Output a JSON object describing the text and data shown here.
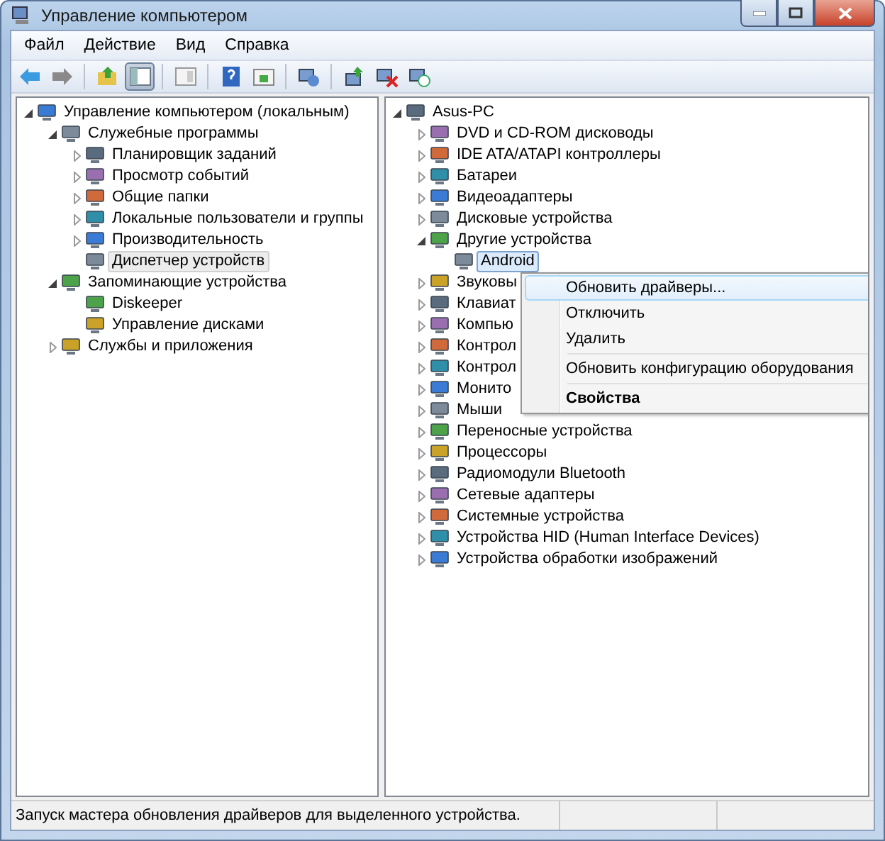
{
  "window": {
    "title": "Управление компьютером"
  },
  "menu_bar": [
    "Файл",
    "Действие",
    "Вид",
    "Справка"
  ],
  "toolbar": [
    [
      {
        "pressed": false
      },
      {
        "pressed": false
      }
    ],
    [
      {
        "pressed": false
      },
      {
        "pressed": true
      }
    ],
    [
      {
        "pressed": false
      }
    ],
    [
      {
        "pressed": false
      },
      {
        "pressed": false
      }
    ],
    [
      {
        "pressed": false
      }
    ],
    [
      {
        "pressed": false
      },
      {
        "pressed": false
      },
      {
        "pressed": false
      }
    ]
  ],
  "left_tree": [
    {
      "label": "Управление компьютером (локальным)",
      "kind": "branch",
      "expanded": true,
      "selected": false,
      "children": [
        {
          "label": "Служебные программы",
          "kind": "branch",
          "expanded": true,
          "selected": false,
          "children": [
            {
              "label": "Планировщик заданий",
              "kind": "branch",
              "expanded": false,
              "selected": false
            },
            {
              "label": "Просмотр событий",
              "kind": "branch",
              "expanded": false,
              "selected": false
            },
            {
              "label": "Общие папки",
              "kind": "branch",
              "expanded": false,
              "selected": false
            },
            {
              "label": "Локальные пользователи и группы",
              "kind": "branch",
              "expanded": false,
              "selected": false
            },
            {
              "label": "Производительность",
              "kind": "branch",
              "expanded": false,
              "selected": false
            },
            {
              "label": "Диспетчер устройств",
              "kind": "leaf",
              "selected": true
            }
          ]
        },
        {
          "label": "Запоминающие устройства",
          "kind": "branch",
          "expanded": true,
          "selected": false,
          "children": [
            {
              "label": "Diskeeper",
              "kind": "leaf",
              "selected": false
            },
            {
              "label": "Управление дисками",
              "kind": "leaf",
              "selected": false
            }
          ]
        },
        {
          "label": "Службы и приложения",
          "kind": "branch",
          "expanded": false,
          "selected": false
        }
      ]
    }
  ],
  "device_tree": [
    {
      "label": "Asus-PC",
      "kind": "branch",
      "expanded": true,
      "selected": false,
      "children": [
        {
          "label": "DVD и CD-ROM дисководы",
          "kind": "branch",
          "expanded": false,
          "selected": false
        },
        {
          "label": "IDE ATA/ATAPI контроллеры",
          "kind": "branch",
          "expanded": false,
          "selected": false
        },
        {
          "label": "Батареи",
          "kind": "branch",
          "expanded": false,
          "selected": false
        },
        {
          "label": "Видеоадаптеры",
          "kind": "branch",
          "expanded": false,
          "selected": false
        },
        {
          "label": "Дисковые устройства",
          "kind": "branch",
          "expanded": false,
          "selected": false
        },
        {
          "label": "Другие устройства",
          "kind": "branch",
          "expanded": true,
          "selected": false,
          "children": [
            {
              "label": "Android",
              "kind": "leaf",
              "selected": true
            }
          ]
        },
        {
          "label": "Звуковы",
          "kind": "branch",
          "expanded": false,
          "selected": false
        },
        {
          "label": "Клавиат",
          "kind": "branch",
          "expanded": false,
          "selected": false
        },
        {
          "label": "Компью",
          "kind": "branch",
          "expanded": false,
          "selected": false
        },
        {
          "label": "Контрол",
          "kind": "branch",
          "expanded": false,
          "selected": false
        },
        {
          "label": "Контрол",
          "kind": "branch",
          "expanded": false,
          "selected": false
        },
        {
          "label": "Монито",
          "kind": "branch",
          "expanded": false,
          "selected": false
        },
        {
          "label": "Мыши",
          "kind": "branch",
          "expanded": false,
          "selected": false
        },
        {
          "label": "Переносные устройства",
          "kind": "branch",
          "expanded": false,
          "selected": false
        },
        {
          "label": "Процессоры",
          "kind": "branch",
          "expanded": false,
          "selected": false
        },
        {
          "label": "Радиомодули Bluetooth",
          "kind": "branch",
          "expanded": false,
          "selected": false
        },
        {
          "label": "Сетевые адаптеры",
          "kind": "branch",
          "expanded": false,
          "selected": false
        },
        {
          "label": "Системные устройства",
          "kind": "branch",
          "expanded": false,
          "selected": false
        },
        {
          "label": "Устройства HID (Human Interface Devices)",
          "kind": "branch",
          "expanded": false,
          "selected": false
        },
        {
          "label": "Устройства обработки изображений",
          "kind": "branch",
          "expanded": false,
          "selected": false
        }
      ]
    }
  ],
  "context_menu": [
    {
      "kind": "item",
      "label": "Обновить драйверы...",
      "highlighted": true,
      "default": false
    },
    {
      "kind": "item",
      "label": "Отключить",
      "highlighted": false,
      "default": false
    },
    {
      "kind": "item",
      "label": "Удалить",
      "highlighted": false,
      "default": false
    },
    {
      "kind": "separator"
    },
    {
      "kind": "item",
      "label": "Обновить конфигурацию оборудования",
      "highlighted": false,
      "default": false
    },
    {
      "kind": "separator"
    },
    {
      "kind": "item",
      "label": "Свойства",
      "highlighted": false,
      "default": true
    }
  ],
  "status_bar": {
    "text": "Запуск мастера обновления драйверов для выделенного устройства."
  }
}
